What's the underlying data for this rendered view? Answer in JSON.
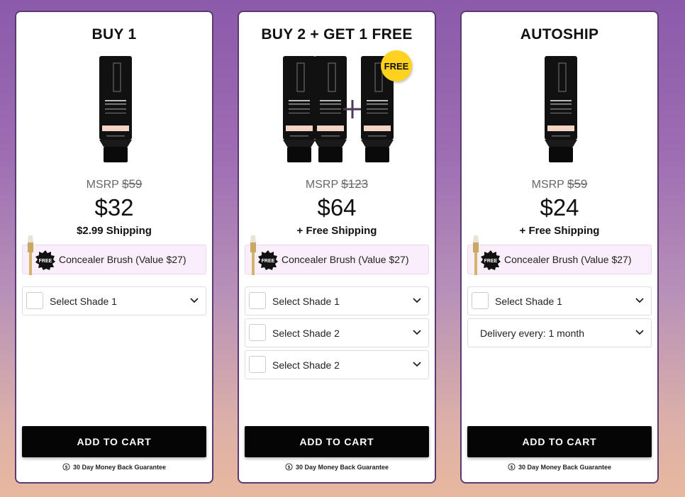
{
  "accent_colors": {
    "background_top": "#8b5aaa",
    "background_bottom": "#e8b89e",
    "card_border": "#5b3a73",
    "gift_bg": "#f9eefa",
    "button": "#050505",
    "free_badge": "#ffd21f"
  },
  "plans": [
    {
      "title": "BUY 1",
      "msrp_label": "MSRP",
      "msrp_value": "$59",
      "price": "$32",
      "shipping": "$2.99 Shipping",
      "gift_badge": "FREE",
      "gift_text": "Concealer Brush (Value $27)",
      "selects": [
        "Select Shade 1"
      ],
      "cta": "ADD TO CART",
      "guarantee": "30 Day Money Back Guarantee"
    },
    {
      "title": "BUY 2 + GET 1 FREE",
      "free_badge": "FREE",
      "msrp_label": "MSRP",
      "msrp_value": "$123",
      "price": "$64",
      "shipping": "+ Free Shipping",
      "gift_badge": "FREE",
      "gift_text": "Concealer Brush (Value $27)",
      "selects": [
        "Select Shade 1",
        "Select Shade 2",
        "Select Shade 2"
      ],
      "cta": "ADD TO CART",
      "guarantee": "30 Day Money Back Guarantee"
    },
    {
      "title": "AUTOSHIP",
      "msrp_label": "MSRP",
      "msrp_value": "$59",
      "price": "$24",
      "shipping": "+ Free Shipping",
      "gift_badge": "FREE",
      "gift_text": "Concealer Brush (Value $27)",
      "selects": [
        "Select Shade 1"
      ],
      "delivery": "Delivery every: 1 month",
      "cta": "ADD TO CART",
      "guarantee": "30 Day Money Back Guarantee"
    }
  ],
  "icons": {
    "gift_badge": "starburst-badge-icon",
    "chevron": "chevron-down-icon",
    "guarantee": "money-back-icon",
    "plus": "plus-icon"
  }
}
